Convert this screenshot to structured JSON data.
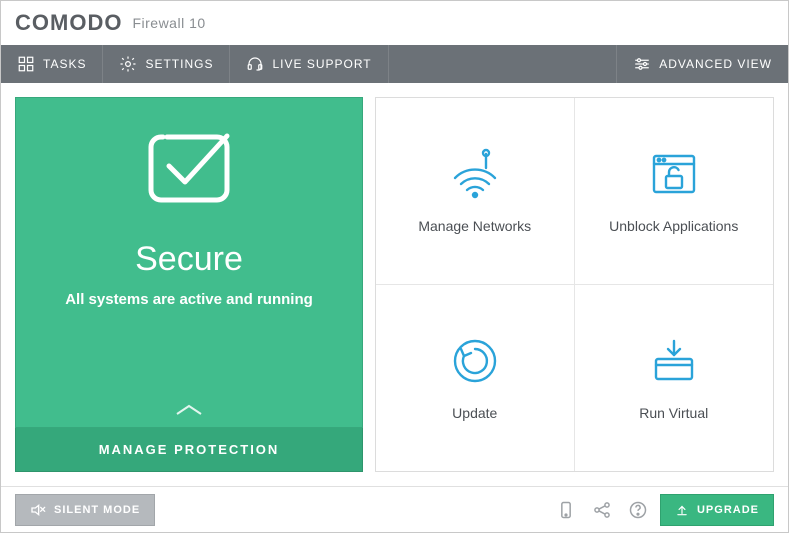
{
  "titlebar": {
    "brand": "COMODO",
    "product": "Firewall  10"
  },
  "menu": {
    "tasks": "TASKS",
    "settings": "SETTINGS",
    "live_support": "LIVE SUPPORT",
    "advanced_view": "ADVANCED VIEW"
  },
  "status": {
    "title": "Secure",
    "subtitle": "All systems are active and running",
    "manage_btn": "MANAGE PROTECTION"
  },
  "tiles": {
    "networks": "Manage Networks",
    "unblock": "Unblock Applications",
    "update": "Update",
    "run_virtual": "Run Virtual"
  },
  "footer": {
    "silent_mode": "SILENT MODE",
    "upgrade": "UPGRADE"
  }
}
